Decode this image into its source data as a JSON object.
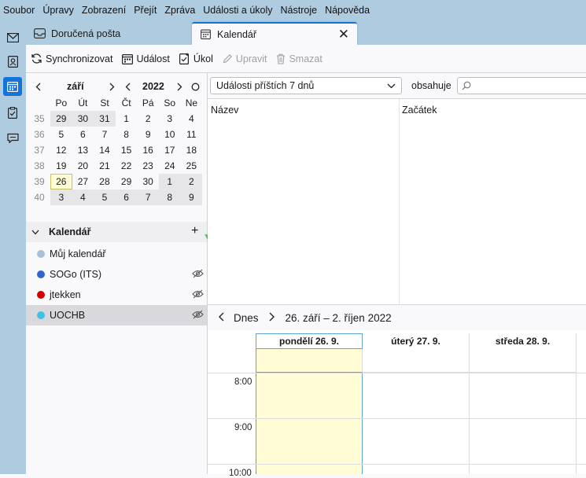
{
  "menu": [
    "Soubor",
    "Úpravy",
    "Zobrazení",
    "Přejít",
    "Zpráva",
    "Události a úkoly",
    "Nástroje",
    "Nápověda"
  ],
  "tabs": [
    {
      "label": "Doručená pošta"
    },
    {
      "label": "Kalendář"
    }
  ],
  "toolbar": {
    "sync": "Synchronizovat",
    "event": "Událost",
    "task": "Úkol",
    "edit": "Upravit",
    "delete": "Smazat"
  },
  "minimonth": {
    "month": "září",
    "year": "2022",
    "weekday_headers": [
      "Po",
      "Út",
      "St",
      "Čt",
      "Pá",
      "So",
      "Ne"
    ],
    "weeks": [
      {
        "wk": "35",
        "days": [
          "29",
          "30",
          "31",
          "1",
          "2",
          "3",
          "4"
        ]
      },
      {
        "wk": "36",
        "days": [
          "5",
          "6",
          "7",
          "8",
          "9",
          "10",
          "11"
        ]
      },
      {
        "wk": "37",
        "days": [
          "12",
          "13",
          "14",
          "15",
          "16",
          "17",
          "18"
        ]
      },
      {
        "wk": "38",
        "days": [
          "19",
          "20",
          "21",
          "22",
          "23",
          "24",
          "25"
        ]
      },
      {
        "wk": "39",
        "days": [
          "26",
          "27",
          "28",
          "29",
          "30",
          "1",
          "2"
        ]
      },
      {
        "wk": "40",
        "days": [
          "3",
          "4",
          "5",
          "6",
          "7",
          "8",
          "9"
        ]
      }
    ]
  },
  "calendars": {
    "section_title": "Kalendář",
    "items": [
      {
        "name": "Můj kalendář",
        "color": "#a8c1d8"
      },
      {
        "name": "SOGo (ITS)",
        "color": "#3366cc"
      },
      {
        "name": "jtekken",
        "color": "#d40000"
      },
      {
        "name": "UOCHB",
        "color": "#3fc1e6"
      }
    ]
  },
  "events_filter": {
    "selected": "Události příštích 7 dnů",
    "contains_label": "obsahuje",
    "search_value": ""
  },
  "event_list": {
    "columns": [
      "Název",
      "Začátek"
    ]
  },
  "week_nav": {
    "today_label": "Dnes",
    "range": "26. září – 2. říjen 2022"
  },
  "week_view": {
    "days": [
      "pondělí 26. 9.",
      "úterý 27. 9.",
      "středa 28. 9."
    ],
    "hours": [
      "8:00",
      "9:00",
      "10:00"
    ]
  },
  "colors": {
    "accent": "#1373d9",
    "today_bg": "#fffcd6",
    "arrow": "#4cc24c"
  }
}
